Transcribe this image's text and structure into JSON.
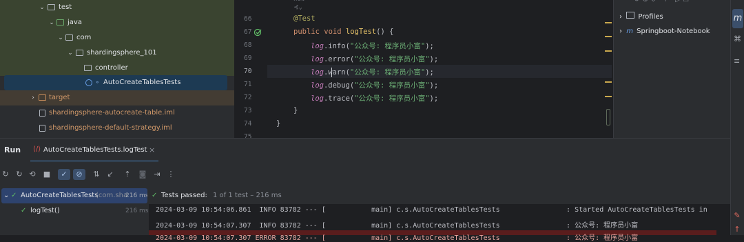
{
  "tree": {
    "items": [
      {
        "label": "test",
        "icon": "folder-icon"
      },
      {
        "label": "java",
        "icon": "folder-icon"
      },
      {
        "label": "com",
        "icon": "folder-icon"
      },
      {
        "label": "shardingsphere_101",
        "icon": "folder-icon"
      },
      {
        "label": "controller",
        "icon": "folder-icon"
      },
      {
        "label": "AutoCreateTablesTests",
        "icon": "class-icon"
      },
      {
        "label": "target",
        "icon": "folder-icon"
      },
      {
        "label": "shardingsphere-autocreate-table.iml",
        "icon": "file-icon"
      },
      {
        "label": "shardingsphere-default-strategy.iml",
        "icon": "file-icon"
      }
    ]
  },
  "editor": {
    "hint": "new",
    "lines": [
      {
        "num": "66",
        "text": "@Test"
      },
      {
        "num": "67",
        "text": "public void logTest() {"
      },
      {
        "num": "68",
        "text": "log.info(\"公众号: 程序员小富\");"
      },
      {
        "num": "69",
        "text": "log.error(\"公众号: 程序员小富\");"
      },
      {
        "num": "70",
        "text": "log.warn(\"公众号: 程序员小富\");"
      },
      {
        "num": "71",
        "text": "log.debug(\"公众号: 程序员小富\");"
      },
      {
        "num": "72",
        "text": "log.trace(\"公众号: 程序员小富\");"
      },
      {
        "num": "73",
        "text": "}"
      },
      {
        "num": "74",
        "text": "}"
      },
      {
        "num": "75",
        "text": ""
      }
    ]
  },
  "maven": {
    "items": [
      {
        "label": "Profiles"
      },
      {
        "label": "Springboot-Notebook"
      }
    ]
  },
  "run": {
    "title": "Run",
    "tab": "AutoCreateTablesTests.logTest",
    "tree": [
      {
        "label": "AutoCreateTablesTests",
        "detail": "(com.sha",
        "time": "216 ms"
      },
      {
        "label": "logTest()",
        "time": "216 ms"
      }
    ],
    "status": "Tests passed:",
    "status_detail": "1 of 1 test – 216 ms",
    "console": [
      "2024-03-09 10:54:06.861  INFO 83782 --- [           main] c.s.AutoCreateTablesTests                : Started AutoCreateTablesTests in",
      "2024-03-09 10:54:07.307  INFO 83782 --- [           main] c.s.AutoCreateTablesTests                : 公众号: 程序员小富",
      "2024-03-09 10:54:07.307 ERROR 83782 --- [           main] c.s.AutoCreateTablesTests                : 公众号: 程序员小富"
    ]
  }
}
